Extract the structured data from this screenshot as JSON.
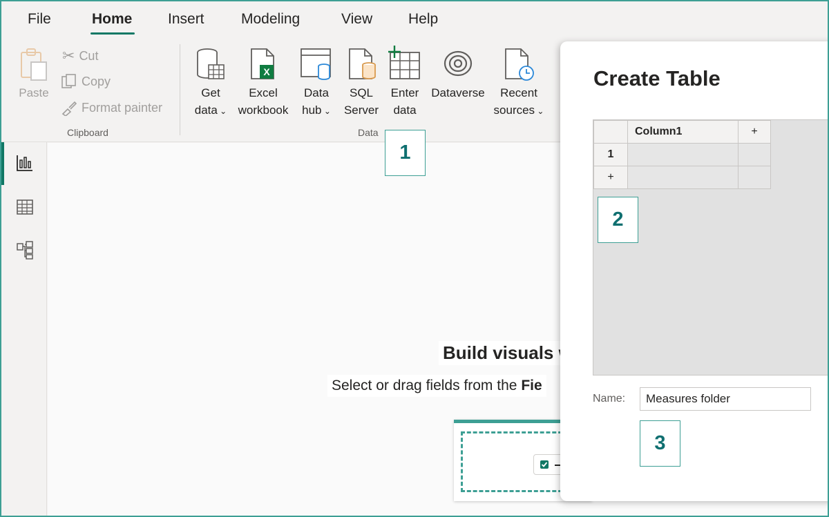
{
  "menu": {
    "items": [
      "File",
      "Home",
      "Insert",
      "Modeling",
      "View",
      "Help"
    ],
    "active": "Home"
  },
  "ribbon": {
    "clipboard": {
      "paste": "Paste",
      "cut": "Cut",
      "copy": "Copy",
      "format_painter": "Format painter",
      "group_label": "Clipboard"
    },
    "data": {
      "get_data": [
        "Get",
        "data"
      ],
      "excel": [
        "Excel",
        "workbook"
      ],
      "data_hub": [
        "Data",
        "hub"
      ],
      "sql": [
        "SQL",
        "Server"
      ],
      "enter_data": [
        "Enter",
        "data"
      ],
      "dataverse": "Dataverse",
      "recent": [
        "Recent",
        "sources"
      ],
      "group_label": "Data"
    }
  },
  "canvas": {
    "title": "Build visuals w",
    "subtitle_prefix": "Select or drag fields from the",
    "subtitle_bold": "Fie"
  },
  "dialog": {
    "title": "Create Table",
    "column_header": "Column1",
    "add_col": "+",
    "row_num": "1",
    "add_row": "+",
    "name_label": "Name:",
    "name_value": "Measures folder"
  },
  "callouts": [
    "1",
    "2",
    "3"
  ],
  "colors": {
    "accent": "#117865",
    "callout": "#3d9f94"
  }
}
